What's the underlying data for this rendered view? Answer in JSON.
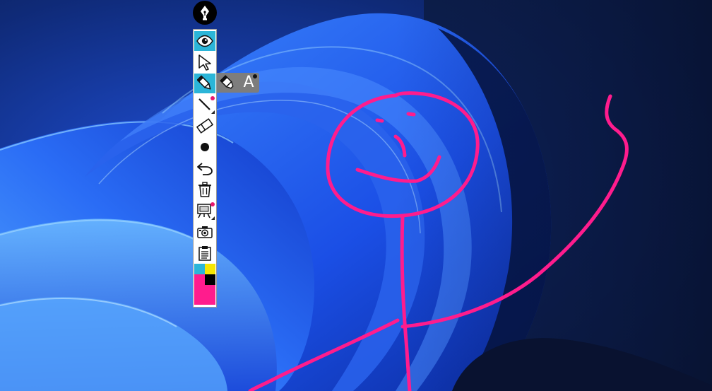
{
  "toolbar": {
    "tools": [
      {
        "id": "visibility",
        "icon": "eye-icon",
        "active": true
      },
      {
        "id": "select",
        "icon": "cursor-arrow-icon",
        "active": false
      },
      {
        "id": "pen",
        "icon": "pen-icon",
        "active": true
      },
      {
        "id": "line",
        "icon": "line-tool-icon",
        "active": false
      },
      {
        "id": "eraser",
        "icon": "eraser-icon",
        "active": false
      },
      {
        "id": "stroke-width",
        "icon": "dot-icon",
        "active": false
      },
      {
        "id": "undo",
        "icon": "undo-icon",
        "active": false
      },
      {
        "id": "clear",
        "icon": "trash-icon",
        "active": false
      },
      {
        "id": "board",
        "icon": "whiteboard-icon",
        "active": false
      },
      {
        "id": "screenshot",
        "icon": "camera-icon",
        "active": false
      },
      {
        "id": "clipboard",
        "icon": "clipboard-icon",
        "active": false
      }
    ],
    "palette": {
      "colors": [
        "#2bb5d8",
        "#f6e600",
        "#000000",
        "#ff1c8d"
      ],
      "current": "#ff1c8d"
    },
    "pen_submenu": {
      "highlighter_icon": "highlighter-icon",
      "text_tool_label": "A"
    }
  },
  "colors": {
    "accent": "#2bb5d8",
    "ink": "#ff1c8d",
    "badge": "#e8166e"
  }
}
